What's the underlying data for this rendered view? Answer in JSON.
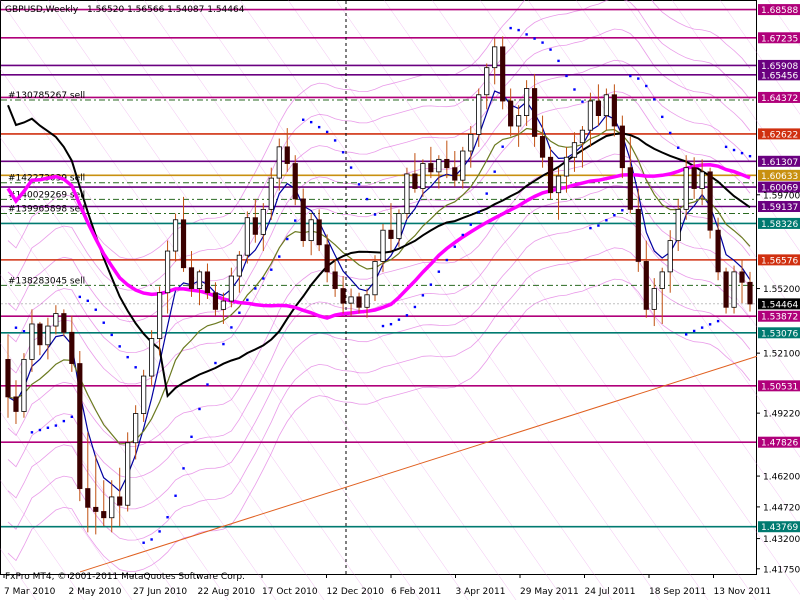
{
  "header": {
    "symbol": "GBPUSD,Weekly",
    "ohlc": "1.56520 1.56566 1.54087 1.54464"
  },
  "footer": {
    "copyright": "FxPro MT4, © 2001-2011 MetaQuotes Software Corp."
  },
  "colors": {
    "background": "#ffffff",
    "bull_candle": "#ffffff",
    "bear_candle": "#3a0000",
    "wick": "#c05010",
    "ma_magenta": "#ff00ff",
    "ma_black": "#000000",
    "ma_olive": "#6b7a20",
    "ma_blue": "#0000a0",
    "psar": "#0000ff",
    "envelope": "#e070e0",
    "trend_line": "#e06020",
    "level_magenta": "#b0007a",
    "level_purple": "#6a0080",
    "level_red": "#d03010",
    "level_teal": "#007a70",
    "level_gold": "#c89010",
    "level_green_dash": "#2a6a20"
  },
  "chart_data": {
    "type": "candlestick",
    "timeframe": "Weekly",
    "symbol": "GBPUSD",
    "y_axis": {
      "range": [
        1.415,
        1.69
      ],
      "tick_labels": [
        "1.68588",
        "1.67235",
        "1.65908",
        "1.65456",
        "1.64372",
        "1.62622",
        "1.61307",
        "1.60633",
        "1.60069",
        "1.59700",
        "1.59137",
        "1.58326",
        "1.56576",
        "1.55200",
        "1.54464",
        "1.53872",
        "1.53076",
        "1.52100",
        "1.50531",
        "1.49220",
        "1.47826",
        "1.46200",
        "1.44720",
        "1.43769",
        "1.43200",
        "1.41750"
      ]
    },
    "x_axis": {
      "tick_labels": [
        "7 Mar 2010",
        "2 May 2010",
        "27 Jun 2010",
        "22 Aug 2010",
        "17 Oct 2010",
        "12 Dec 2010",
        "6 Feb 2011",
        "3 Apr 2011",
        "29 May 2011",
        "24 Jul 2011",
        "18 Sep 2011",
        "13 Nov 2011"
      ]
    },
    "levels": [
      {
        "price": 1.68588,
        "color": "#b0007a",
        "label": "1.68588"
      },
      {
        "price": 1.67235,
        "color": "#b0007a",
        "label": "1.67235"
      },
      {
        "price": 1.65908,
        "color": "#6a0080",
        "label": "1.65908"
      },
      {
        "price": 1.65456,
        "color": "#6a0080",
        "label": "1.65456"
      },
      {
        "price": 1.64372,
        "color": "#b0007a",
        "label": "1.64372"
      },
      {
        "price": 1.62622,
        "color": "#d03010",
        "label": "1.62622"
      },
      {
        "price": 1.61307,
        "color": "#6a0080",
        "label": "1.61307"
      },
      {
        "price": 1.60633,
        "color": "#c89010",
        "label": "1.60633"
      },
      {
        "price": 1.60069,
        "color": "#6a0080",
        "label": "1.60069"
      },
      {
        "price": 1.59137,
        "color": "#6a0080",
        "label": "1.59137"
      },
      {
        "price": 1.58326,
        "color": "#007a70",
        "label": "1.58326"
      },
      {
        "price": 1.56576,
        "color": "#d03010",
        "label": "1.56576"
      },
      {
        "price": 1.53872,
        "color": "#b0007a",
        "label": "1.53872"
      },
      {
        "price": 1.53076,
        "color": "#007a70",
        "label": "1.53076"
      },
      {
        "price": 1.50531,
        "color": "#b0007a",
        "label": "1.50531"
      },
      {
        "price": 1.47826,
        "color": "#b0007a",
        "label": "1.47826"
      },
      {
        "price": 1.43769,
        "color": "#007a70",
        "label": "1.43769"
      }
    ],
    "pending_orders": [
      {
        "label": "#130785267 sell",
        "price": 1.6425
      },
      {
        "label": "#142273039 sell",
        "price": 1.6028
      },
      {
        "label": "#140029269 sell",
        "price": 1.5948
      },
      {
        "label": "#139965898 sell",
        "price": 1.588
      },
      {
        "label": "#138283045 sell",
        "price": 1.5535
      }
    ],
    "current_price": {
      "price": 1.54464,
      "label": "1.54464"
    },
    "candles": [
      [
        1.518,
        1.53,
        1.49,
        1.5
      ],
      [
        1.5,
        1.508,
        1.487,
        1.493
      ],
      [
        1.493,
        1.521,
        1.49,
        1.518
      ],
      [
        1.518,
        1.542,
        1.512,
        1.535
      ],
      [
        1.535,
        1.536,
        1.52,
        1.525
      ],
      [
        1.525,
        1.538,
        1.518,
        1.534
      ],
      [
        1.534,
        1.544,
        1.53,
        1.54
      ],
      [
        1.54,
        1.542,
        1.529,
        1.531
      ],
      [
        1.531,
        1.539,
        1.512,
        1.516
      ],
      [
        1.516,
        1.522,
        1.45,
        1.456
      ],
      [
        1.456,
        1.483,
        1.435,
        1.447
      ],
      [
        1.447,
        1.472,
        1.434,
        1.445
      ],
      [
        1.445,
        1.46,
        1.438,
        1.442
      ],
      [
        1.442,
        1.46,
        1.435,
        1.452
      ],
      [
        1.452,
        1.466,
        1.438,
        1.448
      ],
      [
        1.448,
        1.483,
        1.445,
        1.478
      ],
      [
        1.478,
        1.496,
        1.47,
        1.492
      ],
      [
        1.492,
        1.513,
        1.488,
        1.51
      ],
      [
        1.51,
        1.532,
        1.505,
        1.528
      ],
      [
        1.528,
        1.553,
        1.52,
        1.55
      ],
      [
        1.55,
        1.575,
        1.54,
        1.57
      ],
      [
        1.57,
        1.588,
        1.565,
        1.585
      ],
      [
        1.585,
        1.596,
        1.56,
        1.562
      ],
      [
        1.562,
        1.57,
        1.548,
        1.552
      ],
      [
        1.552,
        1.561,
        1.544,
        1.56
      ],
      [
        1.56,
        1.564,
        1.547,
        1.55
      ],
      [
        1.55,
        1.555,
        1.539,
        1.542
      ],
      [
        1.542,
        1.55,
        1.535,
        1.546
      ],
      [
        1.546,
        1.562,
        1.543,
        1.558
      ],
      [
        1.558,
        1.57,
        1.55,
        1.568
      ],
      [
        1.568,
        1.589,
        1.564,
        1.586
      ],
      [
        1.586,
        1.595,
        1.574,
        1.578
      ],
      [
        1.578,
        1.593,
        1.57,
        1.59
      ],
      [
        1.59,
        1.61,
        1.585,
        1.605
      ],
      [
        1.605,
        1.624,
        1.599,
        1.62
      ],
      [
        1.62,
        1.629,
        1.608,
        1.612
      ],
      [
        1.612,
        1.616,
        1.592,
        1.595
      ],
      [
        1.595,
        1.6,
        1.572,
        1.575
      ],
      [
        1.575,
        1.588,
        1.568,
        1.585
      ],
      [
        1.585,
        1.59,
        1.57,
        1.573
      ],
      [
        1.573,
        1.578,
        1.555,
        1.56
      ],
      [
        1.56,
        1.566,
        1.548,
        1.552
      ],
      [
        1.552,
        1.558,
        1.54,
        1.545
      ],
      [
        1.545,
        1.552,
        1.539,
        1.548
      ],
      [
        1.548,
        1.55,
        1.54,
        1.543
      ],
      [
        1.543,
        1.552,
        1.538,
        1.549
      ],
      [
        1.549,
        1.568,
        1.546,
        1.565
      ],
      [
        1.565,
        1.583,
        1.56,
        1.58
      ],
      [
        1.58,
        1.593,
        1.57,
        1.576
      ],
      [
        1.576,
        1.59,
        1.572,
        1.588
      ],
      [
        1.588,
        1.61,
        1.585,
        1.607
      ],
      [
        1.607,
        1.617,
        1.598,
        1.6
      ],
      [
        1.6,
        1.614,
        1.596,
        1.612
      ],
      [
        1.612,
        1.62,
        1.605,
        1.608
      ],
      [
        1.608,
        1.616,
        1.6,
        1.614
      ],
      [
        1.614,
        1.623,
        1.605,
        1.61
      ],
      [
        1.61,
        1.618,
        1.601,
        1.604
      ],
      [
        1.604,
        1.62,
        1.6,
        1.618
      ],
      [
        1.618,
        1.63,
        1.61,
        1.626
      ],
      [
        1.626,
        1.648,
        1.62,
        1.645
      ],
      [
        1.645,
        1.66,
        1.638,
        1.658
      ],
      [
        1.658,
        1.672,
        1.65,
        1.668
      ],
      [
        1.668,
        1.673,
        1.638,
        1.642
      ],
      [
        1.642,
        1.648,
        1.625,
        1.63
      ],
      [
        1.63,
        1.64,
        1.62,
        1.635
      ],
      [
        1.635,
        1.652,
        1.63,
        1.648
      ],
      [
        1.648,
        1.655,
        1.62,
        1.625
      ],
      [
        1.625,
        1.635,
        1.61,
        1.615
      ],
      [
        1.615,
        1.62,
        1.595,
        1.598
      ],
      [
        1.598,
        1.61,
        1.585,
        1.606
      ],
      [
        1.606,
        1.62,
        1.598,
        1.615
      ],
      [
        1.615,
        1.627,
        1.608,
        1.622
      ],
      [
        1.622,
        1.63,
        1.61,
        1.628
      ],
      [
        1.628,
        1.646,
        1.62,
        1.642
      ],
      [
        1.642,
        1.65,
        1.63,
        1.635
      ],
      [
        1.635,
        1.648,
        1.628,
        1.645
      ],
      [
        1.645,
        1.65,
        1.625,
        1.63
      ],
      [
        1.63,
        1.635,
        1.605,
        1.61
      ],
      [
        1.61,
        1.625,
        1.588,
        1.59
      ],
      [
        1.59,
        1.6,
        1.56,
        1.565
      ],
      [
        1.565,
        1.575,
        1.538,
        1.542
      ],
      [
        1.542,
        1.557,
        1.534,
        1.552
      ],
      [
        1.552,
        1.562,
        1.535,
        1.56
      ],
      [
        1.56,
        1.58,
        1.55,
        1.575
      ],
      [
        1.575,
        1.595,
        1.57,
        1.59
      ],
      [
        1.59,
        1.616,
        1.585,
        1.61
      ],
      [
        1.61,
        1.615,
        1.595,
        1.6
      ],
      [
        1.6,
        1.614,
        1.592,
        1.608
      ],
      [
        1.608,
        1.61,
        1.576,
        1.58
      ],
      [
        1.58,
        1.586,
        1.556,
        1.56
      ],
      [
        1.56,
        1.562,
        1.54,
        1.543
      ],
      [
        1.543,
        1.563,
        1.54,
        1.56
      ],
      [
        1.56,
        1.566,
        1.545,
        1.555
      ],
      [
        1.555,
        1.56,
        1.541,
        1.5446
      ]
    ]
  }
}
